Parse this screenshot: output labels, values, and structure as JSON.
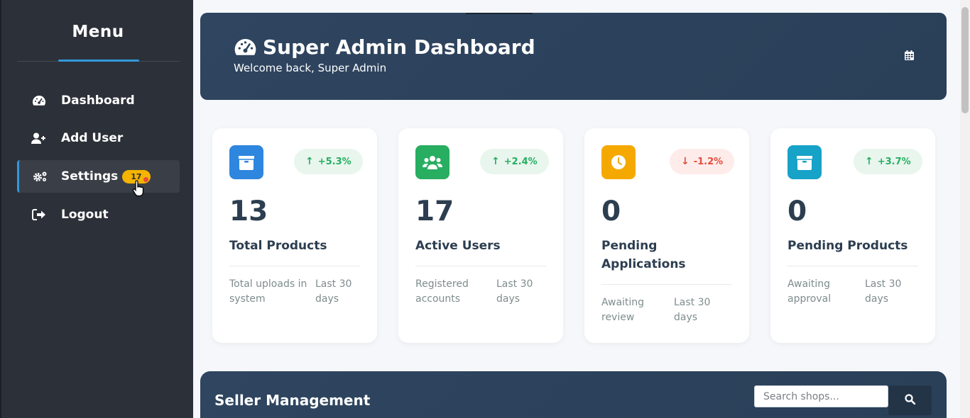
{
  "sidebar": {
    "title": "Menu",
    "items": [
      {
        "label": "Dashboard",
        "icon": "tachometer-icon"
      },
      {
        "label": "Add User",
        "icon": "user-plus-icon"
      },
      {
        "label": "Settings",
        "icon": "cogs-icon",
        "badge": "17"
      },
      {
        "label": "Logout",
        "icon": "sign-out-icon"
      }
    ]
  },
  "header": {
    "title": "Super Admin Dashboard",
    "subtitle": "Welcome back, Super Admin",
    "icon": "tachometer-icon",
    "calendar_icon": "calendar-icon"
  },
  "cards": [
    {
      "value": "13",
      "label": "Total Products",
      "trend": "+5.3%",
      "trend_dir": "up",
      "foot_left": "Total uploads in system",
      "foot_right": "Last 30 days",
      "icon": "box-icon",
      "color": "#2e86de"
    },
    {
      "value": "17",
      "label": "Active Users",
      "trend": "+2.4%",
      "trend_dir": "up",
      "foot_left": "Registered accounts",
      "foot_right": "Last 30 days",
      "icon": "users-icon",
      "color": "#27ae60"
    },
    {
      "value": "0",
      "label": "Pending Applications",
      "trend": "-1.2%",
      "trend_dir": "down",
      "foot_left": "Awaiting review",
      "foot_right": "Last 30 days",
      "icon": "clock-icon",
      "color": "#f5a900"
    },
    {
      "value": "0",
      "label": "Pending Products",
      "trend": "+3.7%",
      "trend_dir": "up",
      "foot_left": "Awaiting approval",
      "foot_right": "Last 30 days",
      "icon": "box-icon",
      "color": "#17a2c8"
    }
  ],
  "seller": {
    "title": "Seller Management",
    "search_placeholder": "Search shops..."
  },
  "colors": {
    "sidebar_bg": "#2c3038",
    "header_bg": "#2f4560",
    "accent": "#3498db",
    "badge": "#f5b400",
    "up": "#27ae60",
    "down": "#e74c3c"
  }
}
